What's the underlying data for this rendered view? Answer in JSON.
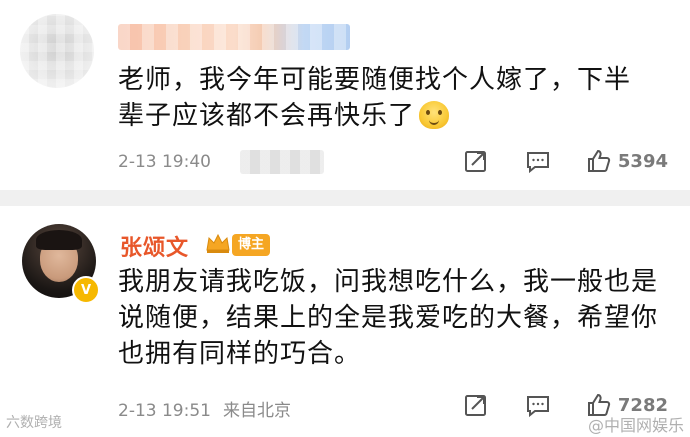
{
  "comment1": {
    "text_line1": "老师，我今年可能要随便找个人嫁了，下半",
    "text_line2": "辈子应该都不会再快乐了",
    "time": "2-13 19:40",
    "like_count": "5394"
  },
  "comment2": {
    "author": "张颂文",
    "badge": "博主",
    "verified_mark": "V",
    "text_line1": "我朋友请我吃饭，问我想吃什么，我一般也是",
    "text_line2": "说随便，结果上的全是我爱吃的大餐，希望你",
    "text_line3": "也拥有同样的巧合。",
    "time": "2-13 19:51",
    "location": "来自北京",
    "like_count": "7282"
  },
  "watermark_left": "六数跨境",
  "watermark_right": "@中国网娱乐",
  "colors": {
    "author": "#e8572a",
    "badge_bg": "#f5a623",
    "meta_text": "#8a8a8a",
    "separator": "#f0f0f0"
  },
  "icons": [
    "share-icon",
    "comment-icon",
    "thumbs-up-icon"
  ]
}
